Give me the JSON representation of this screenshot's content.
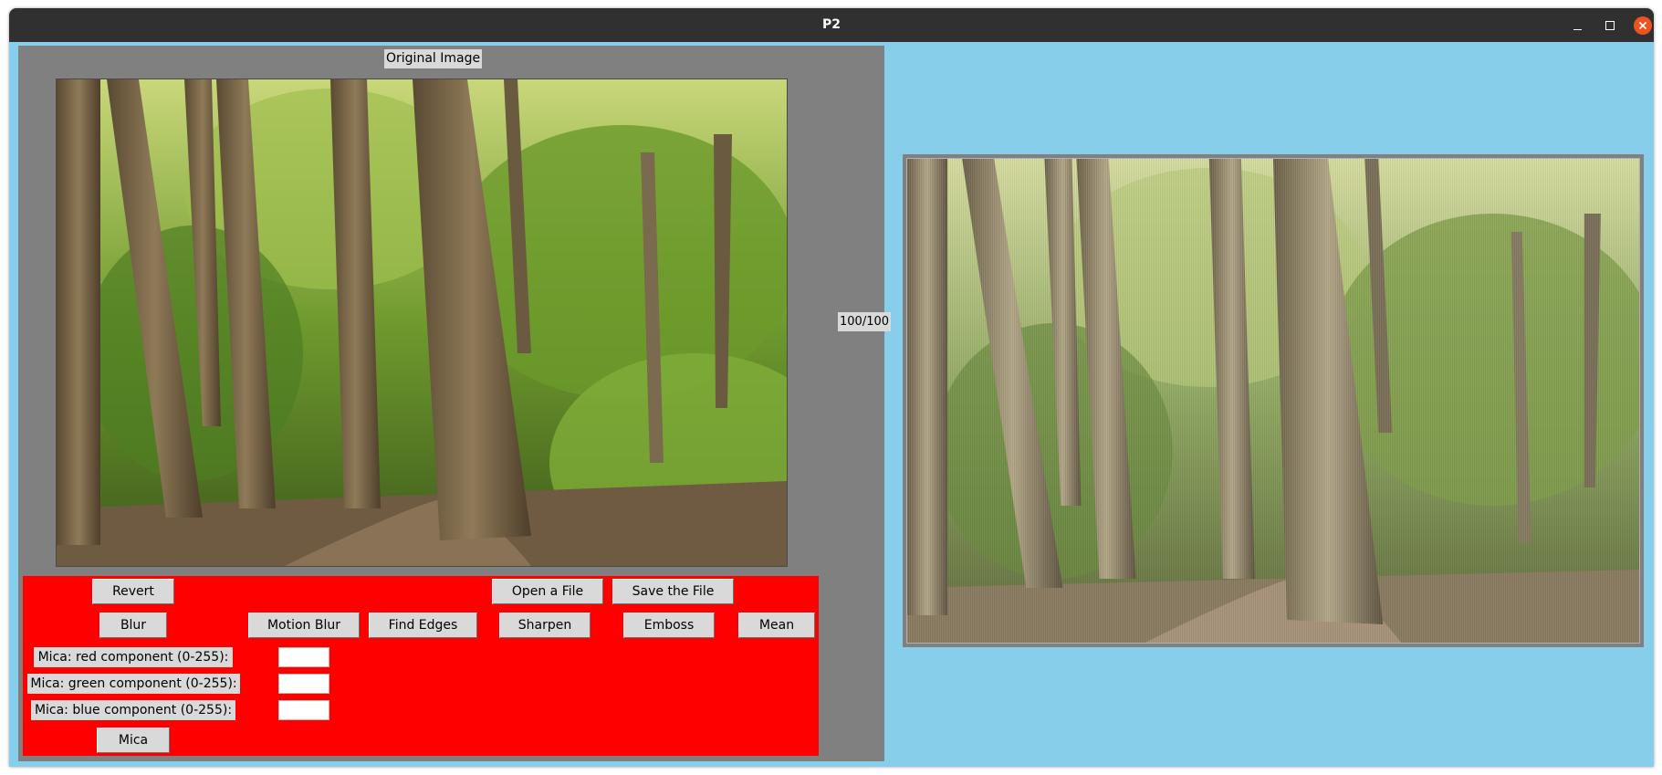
{
  "window": {
    "title": "P2",
    "controls": {
      "minimize_icon": "minimize-icon",
      "maximize_icon": "maximize-icon",
      "close_icon": "close-icon"
    }
  },
  "colors": {
    "window_background": "#87ceeb",
    "panel_background": "#808080",
    "controls_background": "#ff0000",
    "close_button": "#e95420"
  },
  "left_panel": {
    "original_label": "Original Image",
    "scale_label": "100/100"
  },
  "controls": {
    "revert": "Revert",
    "open_file": "Open a File",
    "save_file": "Save the File",
    "blur": "Blur",
    "motion_blur": "Motion Blur",
    "find_edges": "Find Edges",
    "sharpen": "Sharpen",
    "emboss": "Emboss",
    "mean": "Mean",
    "mica_red_label": "Mica: red component (0-255):",
    "mica_green_label": "Mica: green component (0-255):",
    "mica_blue_label": "Mica: blue component (0-255):",
    "mica_red_value": "",
    "mica_green_value": "",
    "mica_blue_value": "",
    "mica": "Mica"
  }
}
